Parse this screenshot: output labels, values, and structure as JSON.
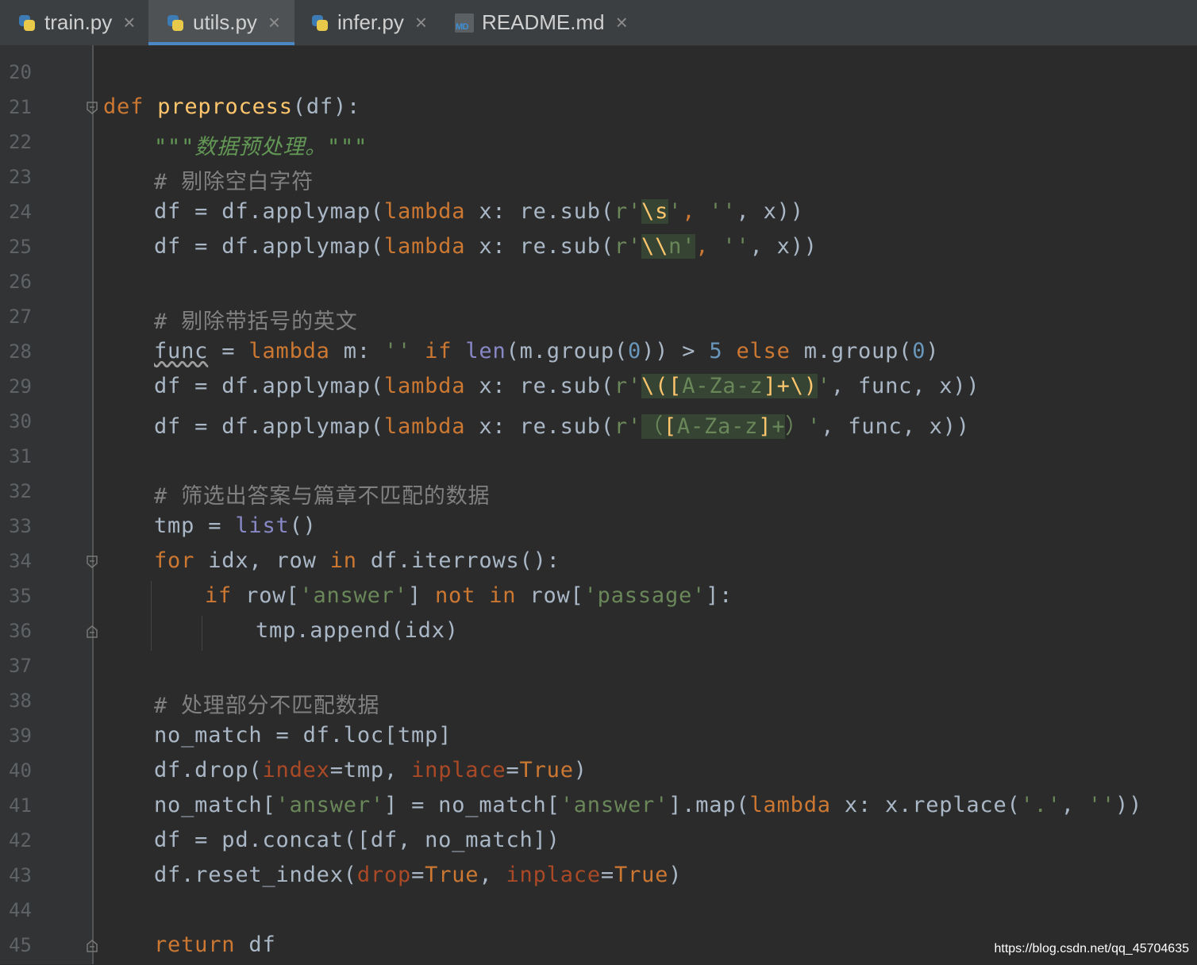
{
  "tabs": [
    {
      "label": "train.py",
      "icon": "python-file-icon",
      "active": false
    },
    {
      "label": "utils.py",
      "icon": "python-file-icon",
      "active": true
    },
    {
      "label": "infer.py",
      "icon": "python-file-icon",
      "active": false
    },
    {
      "label": "README.md",
      "icon": "markdown-file-icon",
      "active": false
    }
  ],
  "tab_close_glyph": "×",
  "md_icon_text": "MD",
  "lines": {
    "n20": "20",
    "n21": "21",
    "n22": "22",
    "n23": "23",
    "n24": "24",
    "n25": "25",
    "n26": "26",
    "n27": "27",
    "n28": "28",
    "n29": "29",
    "n30": "30",
    "n31": "31",
    "n32": "32",
    "n33": "33",
    "n34": "34",
    "n35": "35",
    "n36": "36",
    "n37": "37",
    "n38": "38",
    "n39": "39",
    "n40": "40",
    "n41": "41",
    "n42": "42",
    "n43": "43",
    "n44": "44",
    "n45": "45"
  },
  "code": {
    "l21": {
      "kw": "def",
      "fn": "preprocess",
      "rest": "(df):"
    },
    "l22": {
      "doc": "\"\"\"数据预处理。\"\"\""
    },
    "l23": {
      "cmt": "# 剔除空白字符"
    },
    "l24": {
      "a": "df = df.applymap(",
      "kw": "lambda",
      "b": " x: re.sub(",
      "s1": "r'",
      "esc": "\\s",
      "s2": "'",
      "c": ", ",
      "s3": "''",
      "d": ", x))"
    },
    "l25": {
      "a": "df = df.applymap(",
      "kw": "lambda",
      "b": " x: re.sub(",
      "s1": "r'",
      "esc": "\\\\",
      "s2": "n'",
      "c": ", ",
      "s3": "''",
      "d": ", x))"
    },
    "l27": {
      "cmt": "# 剔除带括号的英文"
    },
    "l28": {
      "var": "func",
      "a": " = ",
      "kw1": "lambda",
      "b": " m: ",
      "s1": "''",
      "c": " ",
      "kw2": "if",
      "d": " ",
      "bi": "len",
      "e": "(m.group(",
      "n1": "0",
      "f": ")) > ",
      "n2": "5",
      "g": " ",
      "kw3": "else",
      "h": " m.group(",
      "n3": "0",
      "i": ")"
    },
    "l29": {
      "a": "df = df.applymap(",
      "kw": "lambda",
      "b": " x: re.sub(",
      "s1": "r'",
      "e1": "\\(",
      "br1": "[",
      "s2": "A-Za-z",
      "br2": "]",
      "e2": "+\\)",
      "s3": "'",
      "c": ", func, x))"
    },
    "l30": {
      "a": "df = df.applymap(",
      "kw": "lambda",
      "b": " x: re.sub(",
      "s1": "r'",
      "s2": "（",
      "br1": "[",
      "s3": "A-Za-z",
      "br2": "]",
      "e2": "+",
      "s4": "）'",
      "c": ", func, x))"
    },
    "l32": {
      "cmt": "# 筛选出答案与篇章不匹配的数据"
    },
    "l33": {
      "a": "tmp = ",
      "bi": "list",
      "b": "()"
    },
    "l34": {
      "kw1": "for",
      "a": " idx, row ",
      "kw2": "in",
      "b": " df.iterrows():"
    },
    "l35": {
      "kw1": "if",
      "a": " row[",
      "s1": "'answer'",
      "b": "] ",
      "kw2": "not in",
      "c": " row[",
      "s2": "'passage'",
      "d": "]:"
    },
    "l36": {
      "a": "tmp.append(idx)"
    },
    "l38": {
      "cmt": "# 处理部分不匹配数据"
    },
    "l39": {
      "a": "no_match = df.loc[tmp]"
    },
    "l40": {
      "a": "df.drop(",
      "p1": "index",
      "b": "=tmp, ",
      "p2": "inplace",
      "c": "=",
      "kw": "True",
      "d": ")"
    },
    "l41": {
      "a": "no_match[",
      "s1": "'answer'",
      "b": "] = no_match[",
      "s2": "'answer'",
      "c": "].map(",
      "kw": "lambda",
      "d": " x: x.replace(",
      "s3": "'.'",
      "e": ", ",
      "s4": "''",
      "f": "))"
    },
    "l42": {
      "a": "df = pd.concat([df, no_match])"
    },
    "l43": {
      "a": "df.reset_index(",
      "p1": "drop",
      "b": "=",
      "kw1": "True",
      "c": ", ",
      "p2": "inplace",
      "d": "=",
      "kw2": "True",
      "e": ")"
    },
    "l45": {
      "kw": "return",
      "a": " df"
    }
  },
  "watermark": "https://blog.csdn.net/qq_45704635",
  "colors": {
    "keyword": "#cc7832",
    "function": "#ffc66d",
    "string": "#6a8759",
    "comment": "#808080",
    "number": "#6897bb",
    "builtin": "#8888c6",
    "param": "#aa4926",
    "background": "#2b2b2b"
  }
}
